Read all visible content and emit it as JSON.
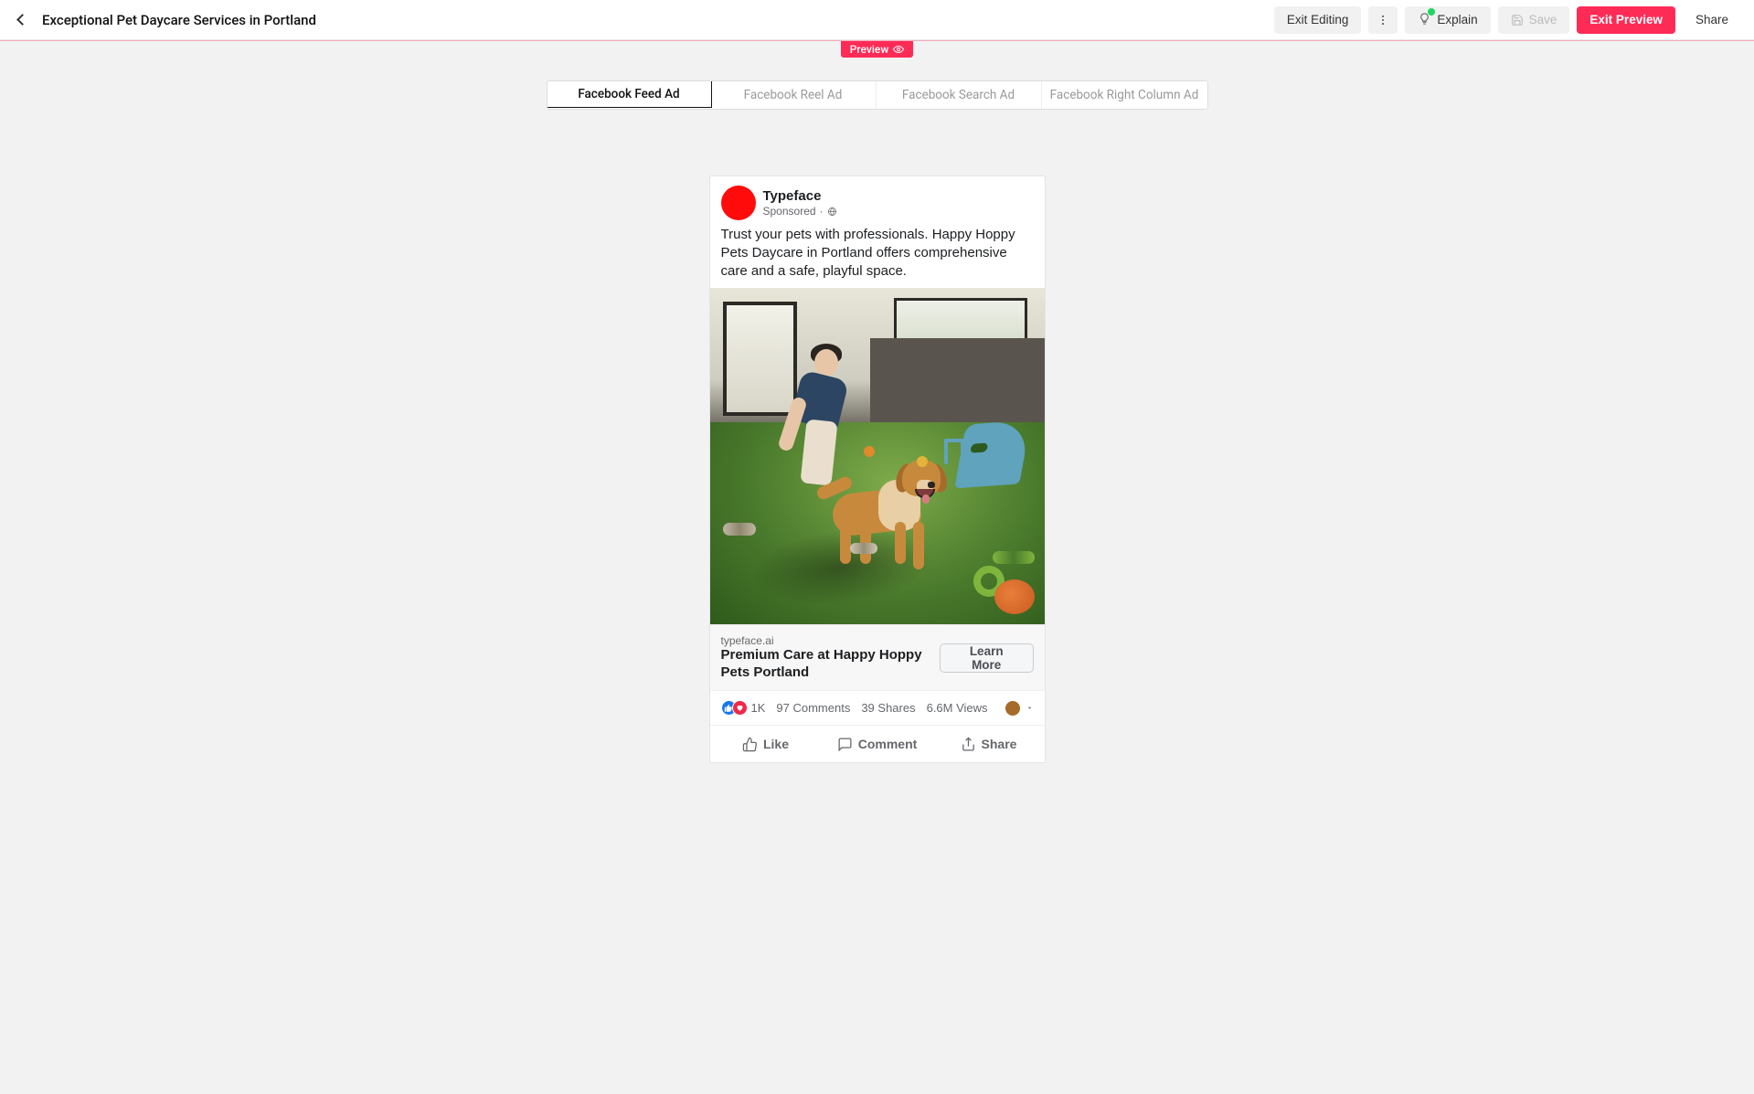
{
  "header": {
    "title": "Exceptional Pet Daycare Services in Portland",
    "exit_editing": "Exit Editing",
    "explain": "Explain",
    "save": "Save",
    "exit_preview": "Exit Preview",
    "share": "Share"
  },
  "preview_badge": "Preview",
  "tabs": [
    "Facebook Feed Ad",
    "Facebook Reel Ad",
    "Facebook Search Ad",
    "Facebook Right Column Ad"
  ],
  "active_tab_index": 0,
  "ad": {
    "page_name": "Typeface",
    "sponsored_label": "Sponsored",
    "body": "Trust your pets with professionals. Happy Hoppy Pets Daycare in Portland offers comprehensive care and a safe, playful space.",
    "domain": "typeface.ai",
    "headline": "Premium Care at Happy Hoppy Pets Portland",
    "cta": "Learn More",
    "reactions_count": "1K",
    "comments": "97 Comments",
    "shares": "39 Shares",
    "views": "6.6M Views",
    "like_label": "Like",
    "comment_label": "Comment",
    "share_label": "Share",
    "image_alt": "Golden retriever and caretaker on indoor turf with toys and a blue slide"
  },
  "colors": {
    "accent": "#ff2b57"
  }
}
